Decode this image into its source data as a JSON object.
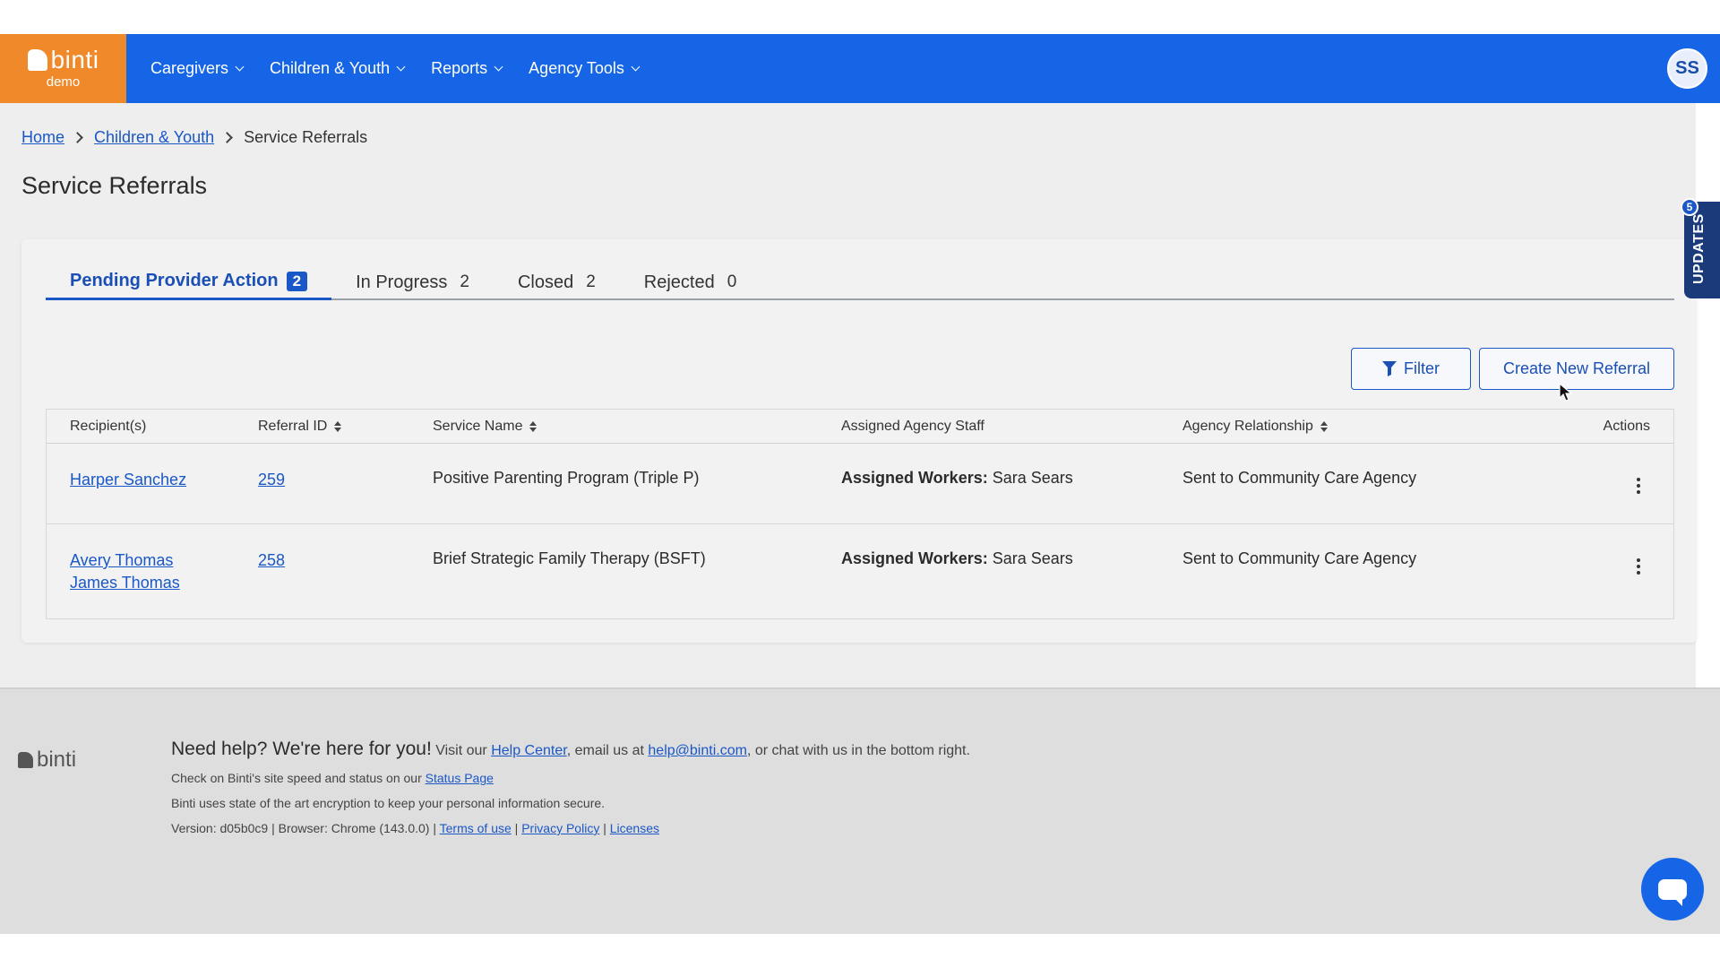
{
  "nav": {
    "logo_text": "binti",
    "logo_sub": "demo",
    "items": [
      {
        "label": "Caregivers"
      },
      {
        "label": "Children & Youth"
      },
      {
        "label": "Reports"
      },
      {
        "label": "Agency Tools"
      }
    ],
    "avatar_initials": "SS"
  },
  "breadcrumb": {
    "home": "Home",
    "section": "Children & Youth",
    "current": "Service Referrals"
  },
  "page_title": "Service Referrals",
  "tabs": [
    {
      "label": "Pending Provider Action",
      "count": "2",
      "active": true
    },
    {
      "label": "In Progress",
      "count": "2"
    },
    {
      "label": "Closed",
      "count": "2"
    },
    {
      "label": "Rejected",
      "count": "0"
    }
  ],
  "buttons": {
    "filter": "Filter",
    "create": "Create New Referral"
  },
  "table": {
    "headers": {
      "recipients": "Recipient(s)",
      "referral_id": "Referral ID",
      "service_name": "Service Name",
      "assigned_staff": "Assigned Agency Staff",
      "agency_relationship": "Agency Relationship",
      "actions": "Actions"
    },
    "rows": [
      {
        "recipients": [
          "Harper Sanchez"
        ],
        "referral_id": "259",
        "service_name": "Positive Parenting Program (Triple P)",
        "staff_label": "Assigned Workers:",
        "staff_value": "Sara Sears",
        "relationship": "Sent to Community Care Agency"
      },
      {
        "recipients": [
          "Avery Thomas",
          "James Thomas"
        ],
        "referral_id": "258",
        "service_name": "Brief Strategic Family Therapy (BSFT)",
        "staff_label": "Assigned Workers:",
        "staff_value": "Sara Sears",
        "relationship": "Sent to Community Care Agency"
      }
    ]
  },
  "updates": {
    "label": "UPDATES",
    "badge": "5"
  },
  "footer": {
    "logo_text": "binti",
    "headline": "Need help? We're here for you!",
    "line1_a": " Visit our ",
    "help_center": "Help Center",
    "line1_b": ", email us at ",
    "email": "help@binti.com",
    "line1_c": ", or chat with us in the bottom right.",
    "line2": "Check on Binti's site speed and status on our ",
    "status_page": "Status Page",
    "line3": "Binti uses state of the art encryption to keep your personal information secure.",
    "line4": "Version: d05b0c9 | Browser: Chrome (143.0.0) | ",
    "terms": "Terms of use",
    "sep": " | ",
    "privacy": "Privacy Policy",
    "licenses": "Licenses"
  },
  "colors": {
    "nav_blue": "#1565e6",
    "logo_orange": "#f0892a",
    "link_blue": "#1a57c7",
    "updates_navy": "#1a3a7a"
  }
}
